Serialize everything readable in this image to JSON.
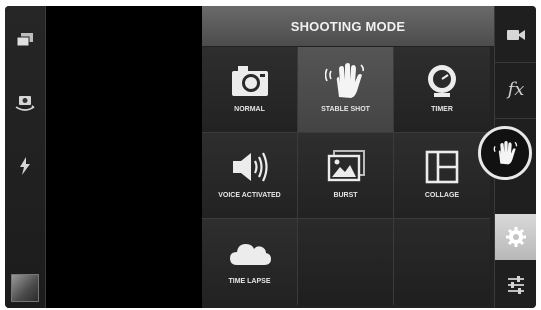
{
  "header": {
    "title": "SHOOTING MODE"
  },
  "modes": [
    {
      "label": "NORMAL",
      "icon": "camera-icon",
      "selected": false
    },
    {
      "label": "STABLE SHOT",
      "icon": "hand-wave-icon",
      "selected": true
    },
    {
      "label": "TIMER",
      "icon": "timer-icon",
      "selected": false
    },
    {
      "label": "VOICE ACTIVATED",
      "icon": "speaker-icon",
      "selected": false
    },
    {
      "label": "BURST",
      "icon": "burst-images-icon",
      "selected": false
    },
    {
      "label": "COLLAGE",
      "icon": "collage-icon",
      "selected": false
    },
    {
      "label": "TIME LAPSE",
      "icon": "cloud-icon",
      "selected": false
    }
  ],
  "left_rail": {
    "icons": [
      "layers-icon",
      "switch-camera-icon",
      "flash-icon",
      "gallery-thumbnail"
    ]
  },
  "right_rail": {
    "icons": [
      "video-camera-icon",
      "effects-icon",
      "shooting-mode-icon",
      "settings-gear-icon",
      "adjustments-icon"
    ],
    "effects_label": "fx"
  },
  "colors": {
    "selected_tile": "#4d4d4d",
    "header": "#5a5a5a",
    "settings_active": "#c8c8c8"
  }
}
